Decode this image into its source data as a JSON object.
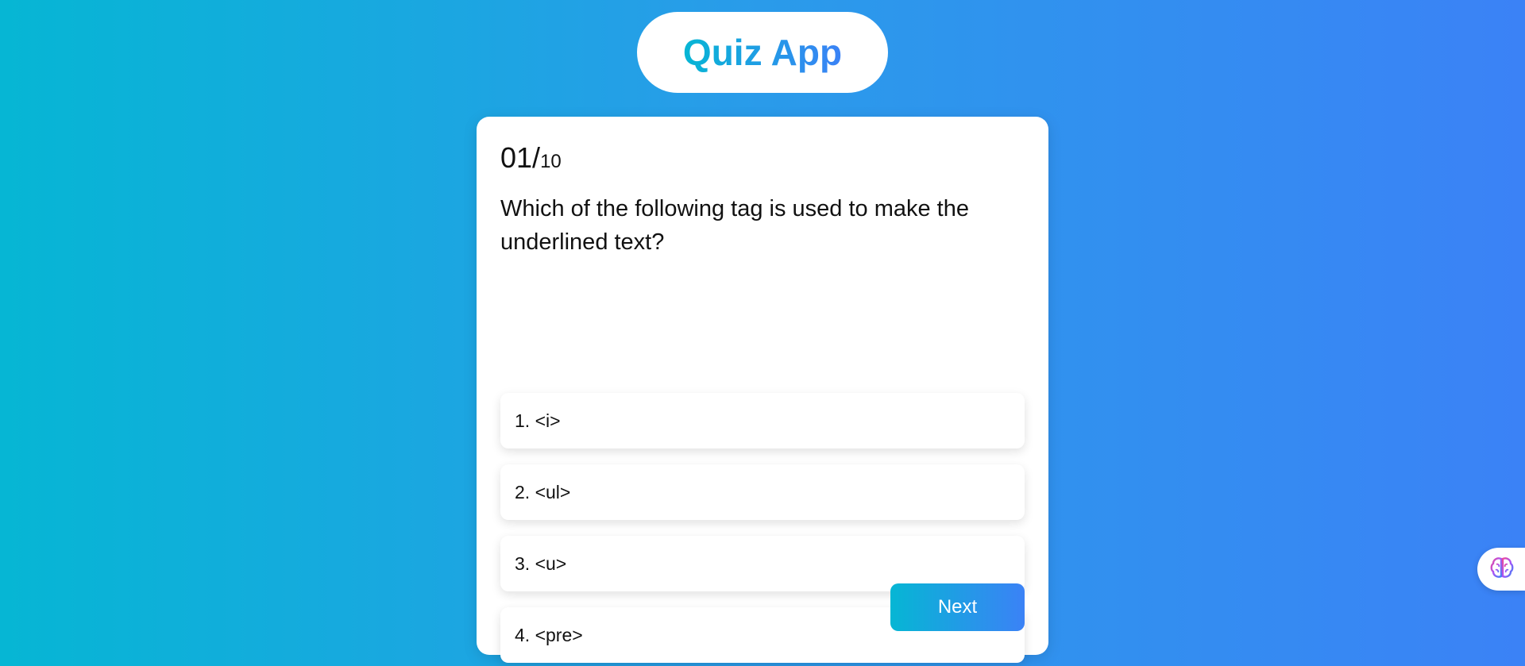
{
  "app": {
    "title": "Quiz App"
  },
  "quiz": {
    "counter": {
      "current": "01",
      "separator": "/",
      "total": "10"
    },
    "question": "Which of the following tag is used to make the underlined text?",
    "options": [
      {
        "label": "1. <i>"
      },
      {
        "label": "2. <ul>"
      },
      {
        "label": "3. <u>"
      },
      {
        "label": "4. <pre>"
      }
    ],
    "next_label": "Next"
  },
  "floating_widget": {
    "icon": "brain-icon"
  },
  "colors": {
    "gradient_start": "#06b6d4",
    "gradient_end": "#3b82f6",
    "card_background": "#ffffff"
  }
}
